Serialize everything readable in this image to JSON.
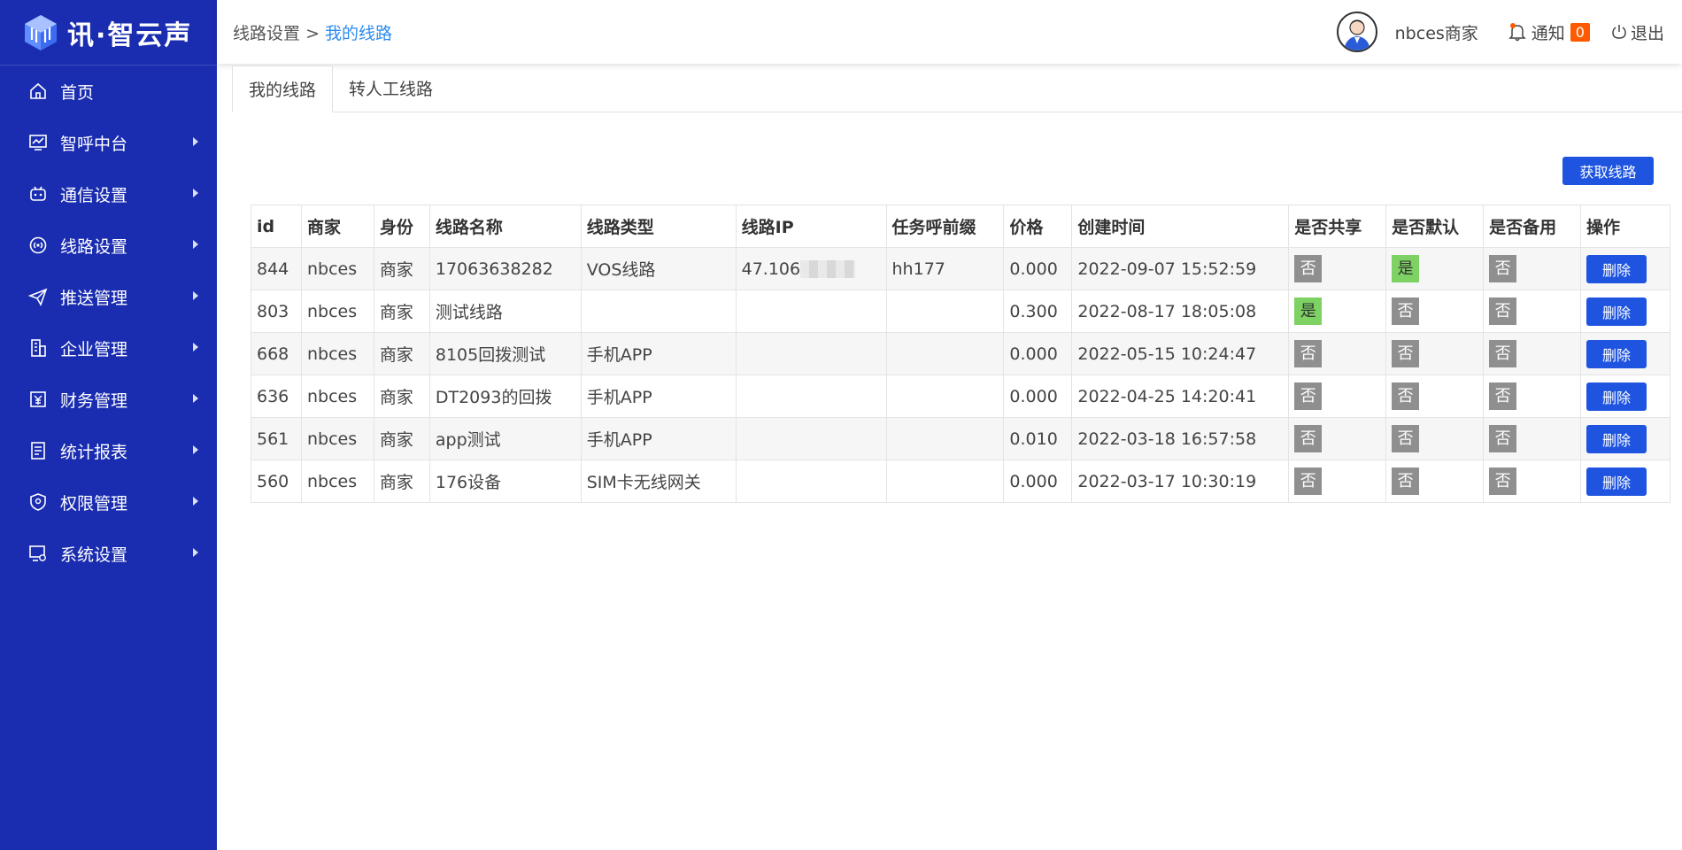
{
  "app": {
    "logo_text": "讯·智云声"
  },
  "sidebar": {
    "items": [
      {
        "label": "首页",
        "icon": "home-icon",
        "has_submenu": false
      },
      {
        "label": "智呼中台",
        "icon": "monitor-chart-icon",
        "has_submenu": true
      },
      {
        "label": "通信设置",
        "icon": "robot-icon",
        "has_submenu": true
      },
      {
        "label": "线路设置",
        "icon": "signal-icon",
        "has_submenu": true
      },
      {
        "label": "推送管理",
        "icon": "paper-plane-icon",
        "has_submenu": true
      },
      {
        "label": "企业管理",
        "icon": "building-icon",
        "has_submenu": true
      },
      {
        "label": "财务管理",
        "icon": "finance-icon",
        "has_submenu": true
      },
      {
        "label": "统计报表",
        "icon": "report-icon",
        "has_submenu": true
      },
      {
        "label": "权限管理",
        "icon": "shield-icon",
        "has_submenu": true
      },
      {
        "label": "系统设置",
        "icon": "settings-screen-icon",
        "has_submenu": true
      }
    ]
  },
  "header": {
    "breadcrumb_parent": "线路设置",
    "breadcrumb_sep": ">",
    "breadcrumb_current": "我的线路",
    "username": "nbces商家",
    "notify_label": "通知",
    "notify_count": "0",
    "logout_label": "退出"
  },
  "tabs": [
    {
      "label": "我的线路",
      "active": true
    },
    {
      "label": "转人工线路",
      "active": false
    }
  ],
  "toolbar": {
    "get_lines_label": "获取线路"
  },
  "table": {
    "columns": [
      "id",
      "商家",
      "身份",
      "线路名称",
      "线路类型",
      "线路IP",
      "任务呼前缀",
      "价格",
      "创建时间",
      "是否共享",
      "是否默认",
      "是否备用",
      "操作"
    ],
    "delete_label": "删除",
    "yes": "是",
    "no": "否",
    "rows": [
      {
        "id": "844",
        "merchant": "nbces",
        "role": "商家",
        "name": "17063638282",
        "type": "VOS线路",
        "ip": "47.106",
        "ip_masked": true,
        "prefix": "hh177",
        "price": "0.000",
        "created": "2022-09-07 15:52:59",
        "shared": false,
        "default": true,
        "backup": false
      },
      {
        "id": "803",
        "merchant": "nbces",
        "role": "商家",
        "name": "测试线路",
        "type": "",
        "ip": "",
        "ip_masked": false,
        "prefix": "",
        "price": "0.300",
        "created": "2022-08-17 18:05:08",
        "shared": true,
        "default": false,
        "backup": false
      },
      {
        "id": "668",
        "merchant": "nbces",
        "role": "商家",
        "name": "8105回拨测试",
        "type": "手机APP",
        "ip": "",
        "ip_masked": false,
        "prefix": "",
        "price": "0.000",
        "created": "2022-05-15 10:24:47",
        "shared": false,
        "default": false,
        "backup": false
      },
      {
        "id": "636",
        "merchant": "nbces",
        "role": "商家",
        "name": "DT2093的回拨",
        "type": "手机APP",
        "ip": "",
        "ip_masked": false,
        "prefix": "",
        "price": "0.000",
        "created": "2022-04-25 14:20:41",
        "shared": false,
        "default": false,
        "backup": false
      },
      {
        "id": "561",
        "merchant": "nbces",
        "role": "商家",
        "name": "app测试",
        "type": "手机APP",
        "ip": "",
        "ip_masked": false,
        "prefix": "",
        "price": "0.010",
        "created": "2022-03-18 16:57:58",
        "shared": false,
        "default": false,
        "backup": false
      },
      {
        "id": "560",
        "merchant": "nbces",
        "role": "商家",
        "name": "176设备",
        "type": "SIM卡无线网关",
        "ip": "",
        "ip_masked": false,
        "prefix": "",
        "price": "0.000",
        "created": "2022-03-17 10:30:19",
        "shared": false,
        "default": false,
        "backup": false
      }
    ]
  },
  "colors": {
    "sidebar_bg": "#1a2db0",
    "primary": "#1e54e0",
    "link": "#2d8cf0",
    "yes_flag": "#7ed163",
    "no_flag": "#8f8f8f",
    "badge": "#ff5a00"
  }
}
